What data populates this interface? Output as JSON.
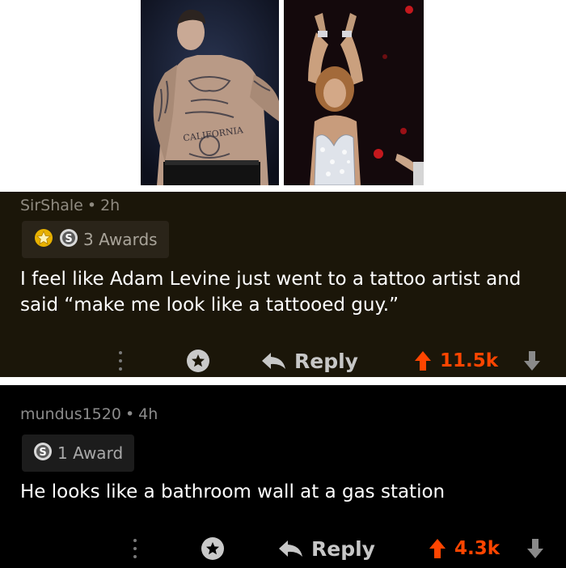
{
  "comments": [
    {
      "username": "SirShale",
      "separator": "•",
      "time": "2h",
      "awards_label": "3 Awards",
      "body": "I feel like Adam Levine just went to a tattoo artist and said “make me look like a tattooed guy.”",
      "reply_label": "Reply",
      "score": "11.5k"
    },
    {
      "username": "mundus1520",
      "separator": "•",
      "time": "4h",
      "awards_label": "1 Award",
      "body": "He looks like a bathroom wall at a gas station",
      "reply_label": "Reply",
      "score": "4.3k"
    }
  ],
  "photo_text": {
    "tattoo_lettering": "CALIFORNIA"
  },
  "colors": {
    "upvote": "#ff4500",
    "comment1_bg": "#1b1609",
    "comment2_bg": "#000000"
  }
}
